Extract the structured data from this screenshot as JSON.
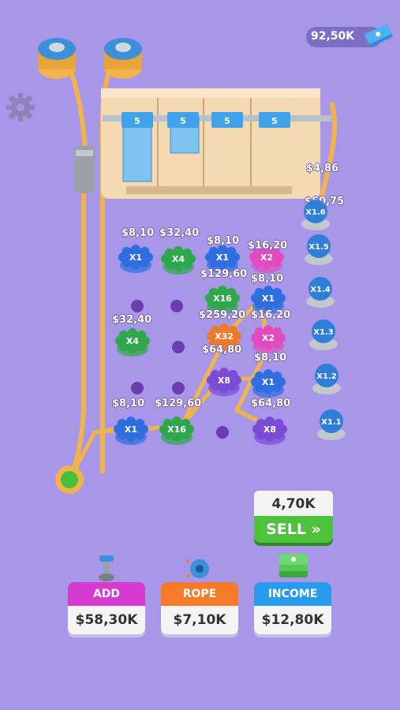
{
  "header": {
    "money": "92,50K",
    "cash_icon": "cash-stack-icon",
    "settings_icon": "gear-icon"
  },
  "colors": {
    "background": "#a897e8",
    "sell": "#4ec23a",
    "add_pulley": "#d63bd0",
    "rope_speed": "#f57b2a",
    "income": "#2a9bec",
    "rope": "#f1b44a"
  },
  "board": {
    "bills": [
      "5",
      "5",
      "5",
      "5"
    ],
    "top_labels": [
      "$4,86",
      "$60,75"
    ],
    "side_pulleys": [
      "X1.6",
      "X1.5",
      "X1.4",
      "X1.3",
      "X1.2",
      "X1.1"
    ],
    "pulleys": [
      {
        "mult": "X1",
        "price": "$8,10",
        "color": "#2f6ee0"
      },
      {
        "mult": "X4",
        "price": "$32,40",
        "color": "#2ea84a"
      },
      {
        "mult": "X1",
        "price": "$8,10",
        "color": "#2f6ee0"
      },
      {
        "mult": "X2",
        "price": "$16,20",
        "color": "#e24ac2"
      },
      {
        "mult": "X16",
        "price": "$129,60",
        "color": "#2ea84a"
      },
      {
        "mult": "X1",
        "price": "$8,10",
        "color": "#2f6ee0"
      },
      {
        "mult": "X4",
        "price": "$32,40",
        "color": "#2ea84a"
      },
      {
        "mult": "X32",
        "price": "$259,20",
        "color": "#f07a2c"
      },
      {
        "mult": "X2",
        "price": "$16,20",
        "color": "#e24ac2"
      },
      {
        "mult": "X8",
        "price": "$64,80",
        "color": "#7b4ad6"
      },
      {
        "mult": "X1",
        "price": "$8,10",
        "color": "#2f6ee0"
      },
      {
        "mult": "X1",
        "price": "$8,10",
        "color": "#2f6ee0"
      },
      {
        "mult": "X16",
        "price": "$129,60",
        "color": "#2ea84a"
      },
      {
        "mult": "X8",
        "price": "$64,80",
        "color": "#7b4ad6"
      }
    ]
  },
  "sell": {
    "amount": "4,70K",
    "label": "SELL"
  },
  "upgrades": [
    {
      "title": "ADD PULLEY",
      "price": "$58,30K",
      "icon": "pulley-icon"
    },
    {
      "title": "ROPE SPEED",
      "price": "$7,10K",
      "icon": "gear-icon"
    },
    {
      "title": "INCOME",
      "price": "$12,80K",
      "icon": "cash-stack-icon"
    }
  ]
}
